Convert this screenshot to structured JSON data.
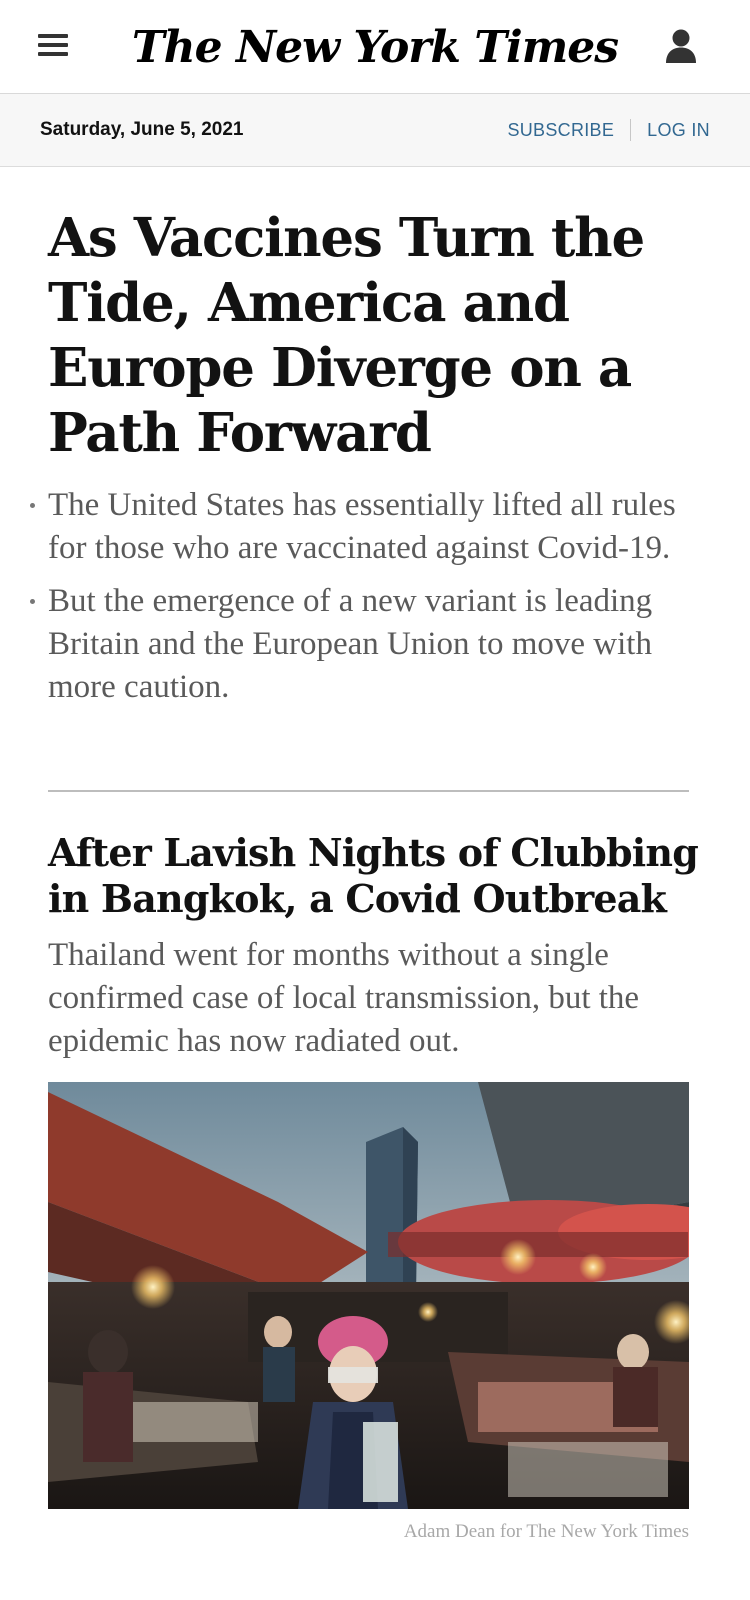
{
  "header": {
    "logo_text": "The New York Times",
    "menu_icon": "hamburger-menu-icon",
    "account_icon": "user-account-icon"
  },
  "datebar": {
    "date": "Saturday, June 5, 2021",
    "subscribe_label": "SUBSCRIBE",
    "login_label": "LOG IN",
    "link_color": "#326891"
  },
  "lead_story": {
    "headline": "As Vaccines Turn the Tide, America and Europe Diverge on a Path Forward",
    "bullets": [
      "The United States has essentially lifted all rules for those who are vaccinated against Covid-19.",
      "But the emergence of a new variant is leading Britain and the European Union to move with more caution."
    ]
  },
  "second_story": {
    "headline": "After Lavish Nights of Clubbing in Bangkok, a Covid Outbreak",
    "summary": "Thailand went for months without a single confirmed case of local transmission, but the epidemic has now radiated out.",
    "image_credit": "Adam Dean for The New York Times"
  }
}
